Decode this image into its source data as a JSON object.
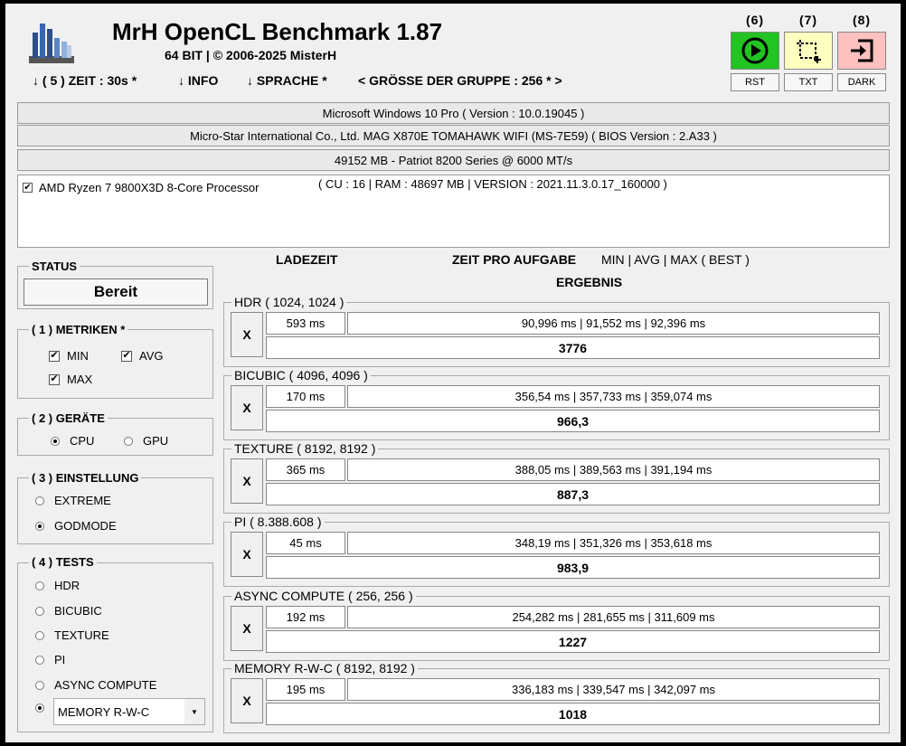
{
  "header": {
    "title": "MrH OpenCL Benchmark 1.87",
    "subtitle": "64 BIT | ©  2006-2025 MisterH",
    "menu": {
      "time": "↓ ( 5 ) ZEIT : 30s *",
      "info": "↓ INFO",
      "language": "↓ SPRACHE *",
      "group_size": "< GRÖSSE DER GRUPPE : 256 * >"
    }
  },
  "toolbar": {
    "buttons": [
      {
        "number": "(6)",
        "label": "RST",
        "icon": "play-icon",
        "color": "#22c322"
      },
      {
        "number": "(7)",
        "label": "TXT",
        "icon": "crop-icon",
        "color": "#ffffc0"
      },
      {
        "number": "(8)",
        "label": "DARK",
        "icon": "enter-icon",
        "color": "#ffc0c0"
      }
    ]
  },
  "system": {
    "os": "Microsoft Windows 10 Pro ( Version : 10.0.19045 )",
    "board": "Micro-Star International Co., Ltd. MAG X870E TOMAHAWK WIFI (MS-7E59) ( BIOS Version : 2.A33 )",
    "memory": "49152 MB - Patriot 8200 Series @ 6000 MT/s",
    "device_name": "AMD Ryzen 7 9800X3D 8-Core Processor",
    "device_info": "( CU : 16 | RAM : 48697 MB | VERSION : 2021.11.3.0.17_160000 )",
    "device_checked": true
  },
  "status": {
    "label": "STATUS",
    "value": "Bereit"
  },
  "metrics": {
    "label": "( 1 ) METRIKEN *",
    "min": "MIN",
    "avg": "AVG",
    "max": "MAX"
  },
  "devices": {
    "label": "( 2 ) GERÄTE",
    "cpu": "CPU",
    "gpu": "GPU",
    "selected": "CPU"
  },
  "settings": {
    "label": "( 3 ) EINSTELLUNG",
    "extreme": "EXTREME",
    "godmode": "GODMODE",
    "selected": "GODMODE"
  },
  "tests_panel": {
    "label": "( 4 ) TESTS",
    "options": [
      "HDR",
      "BICUBIC",
      "TEXTURE",
      "PI",
      "ASYNC COMPUTE"
    ],
    "selected": "MEMORY R-W-C"
  },
  "results_header": {
    "load_time": "LADEZEIT",
    "time_per_task": "ZEIT PRO AUFGABE",
    "min_avg_max": "MIN | AVG | MAX ( BEST )",
    "result": "ERGEBNIS"
  },
  "tests": [
    {
      "name": "HDR ( 1024, 1024 )",
      "load": "593 ms",
      "times": "90,996 ms | 91,552 ms | 92,396 ms",
      "result": "3776"
    },
    {
      "name": "BICUBIC ( 4096, 4096 )",
      "load": "170 ms",
      "times": "356,54 ms | 357,733 ms | 359,074 ms",
      "result": "966,3"
    },
    {
      "name": "TEXTURE ( 8192, 8192 )",
      "load": "365 ms",
      "times": "388,05 ms | 389,563 ms | 391,194 ms",
      "result": "887,3"
    },
    {
      "name": "PI ( 8.388.608 )",
      "load": "45 ms",
      "times": "348,19 ms | 351,326 ms | 353,618 ms",
      "result": "983,9"
    },
    {
      "name": "ASYNC COMPUTE ( 256, 256 )",
      "load": "192 ms",
      "times": "254,282 ms | 281,655 ms | 311,609 ms",
      "result": "1227"
    },
    {
      "name": "MEMORY R-W-C ( 8192, 8192 )",
      "load": "195 ms",
      "times": "336,183 ms | 339,547 ms | 342,097 ms",
      "result": "1018"
    }
  ],
  "x_label": "X"
}
